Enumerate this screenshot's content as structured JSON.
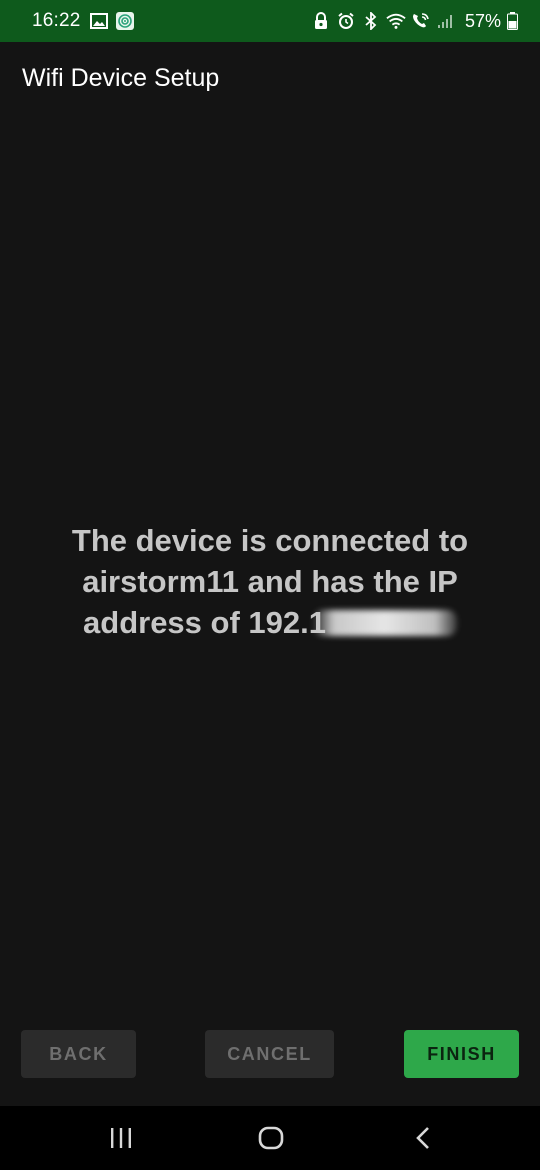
{
  "status_bar": {
    "time": "16:22",
    "battery_percent": "57%",
    "left_icons": [
      "image-icon",
      "app-notification-icon"
    ],
    "right_icons": [
      "lock-icon",
      "alarm-icon",
      "bluetooth-icon",
      "wifi-icon",
      "wifi-calling-icon",
      "signal-icon",
      "battery-icon"
    ],
    "background": "#0e5a1c"
  },
  "app_bar": {
    "title": "Wifi Device Setup"
  },
  "message": {
    "text": "The device is connected to airstorm11 and has the IP address of ",
    "ip_visible": "192.1"
  },
  "buttons": {
    "back": "BACK",
    "cancel": "CANCEL",
    "finish": "FINISH"
  },
  "colors": {
    "background": "#141414",
    "finish_button": "#2ea84a",
    "disabled_button": "#2b2b2b"
  },
  "nav_bar": {
    "icons": [
      "recent-apps-icon",
      "home-icon",
      "back-icon"
    ]
  }
}
